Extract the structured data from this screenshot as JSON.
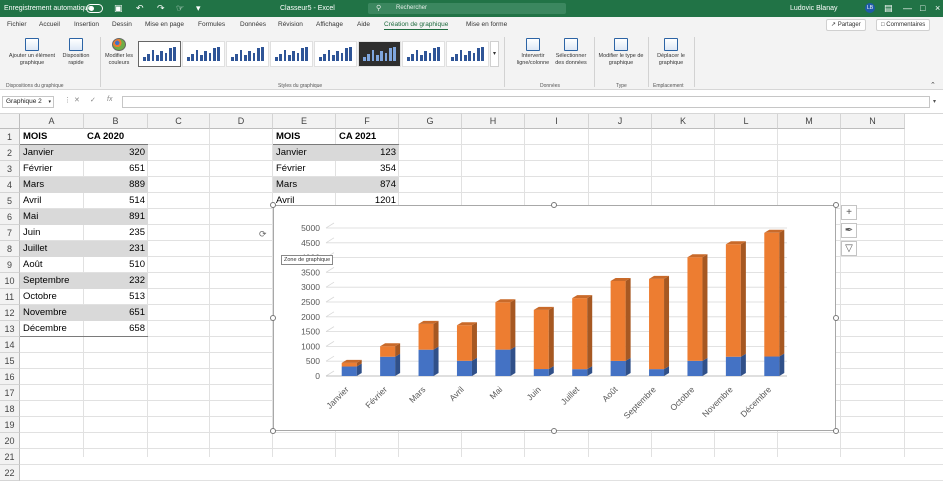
{
  "titlebar": {
    "autosave_label": "Enregistrement automatique",
    "filename": "Classeur5 - Excel",
    "search_placeholder": "Rechercher",
    "user_name": "Ludovic Blanay",
    "user_initials": "LB"
  },
  "menu": {
    "tabs": [
      "Fichier",
      "Accueil",
      "Insertion",
      "Dessin",
      "Mise en page",
      "Formules",
      "Données",
      "Révision",
      "Affichage",
      "Aide",
      "Création de graphique",
      "Mise en forme"
    ],
    "active_tab": "Création de graphique",
    "share_label": "Partager",
    "comments_label": "Commentaires"
  },
  "ribbon": {
    "add_element": "Ajouter un élément graphique",
    "quick_layout": "Disposition rapide",
    "change_colors": "Modifier les couleurs",
    "switch_row_col": "Intervertir ligne/colonne",
    "select_data": "Sélectionner des données",
    "change_type": "Modifier le type de graphique",
    "move_chart": "Déplacer le graphique",
    "groups": {
      "layouts": "Dispositions du graphique",
      "styles": "Styles du graphique",
      "data": "Données",
      "type": "Type",
      "location": "Emplacement"
    }
  },
  "formula_bar": {
    "name_box": "Graphique 2",
    "fx": "fx",
    "formula": ""
  },
  "sheet": {
    "columns": [
      "A",
      "B",
      "C",
      "D",
      "E",
      "F",
      "G",
      "H",
      "I",
      "J",
      "K",
      "L",
      "M",
      "N"
    ],
    "rows": [
      "1",
      "2",
      "3",
      "4",
      "5",
      "6",
      "7",
      "8",
      "9",
      "10",
      "11",
      "12",
      "13",
      "14",
      "15",
      "16",
      "17",
      "18",
      "19",
      "20",
      "21",
      "22"
    ],
    "table1": {
      "headers": [
        "MOIS",
        "CA 2020"
      ],
      "rows": [
        [
          "Janvier",
          "320"
        ],
        [
          "Février",
          "651"
        ],
        [
          "Mars",
          "889"
        ],
        [
          "Avril",
          "514"
        ],
        [
          "Mai",
          "891"
        ],
        [
          "Juin",
          "235"
        ],
        [
          "Juillet",
          "231"
        ],
        [
          "Août",
          "510"
        ],
        [
          "Septembre",
          "232"
        ],
        [
          "Octobre",
          "513"
        ],
        [
          "Novembre",
          "651"
        ],
        [
          "Décembre",
          "658"
        ]
      ]
    },
    "table2": {
      "headers": [
        "MOIS",
        "CA 2021"
      ],
      "rows": [
        [
          "Janvier",
          "123"
        ],
        [
          "Février",
          "354"
        ],
        [
          "Mars",
          "874"
        ],
        [
          "Avril",
          "1201"
        ]
      ]
    }
  },
  "chart_tooltip": "Zone de graphique",
  "chart_data": {
    "type": "bar",
    "stacked": true,
    "three_d": true,
    "categories": [
      "Janvier",
      "Février",
      "Mars",
      "Avril",
      "Mai",
      "Juin",
      "Juillet",
      "Août",
      "Septembre",
      "Octobre",
      "Novembre",
      "Décembre"
    ],
    "series": [
      {
        "values": [
          320,
          651,
          889,
          514,
          891,
          235,
          231,
          510,
          232,
          513,
          651,
          658
        ],
        "color": "#4472c4"
      },
      {
        "values": [
          123,
          354,
          874,
          1201,
          1600,
          2000,
          2400,
          2700,
          3050,
          3500,
          3800,
          4180
        ],
        "color": "#ed7d31"
      }
    ],
    "y_ticks": [
      "0",
      "500",
      "1000",
      "1500",
      "2000",
      "2500",
      "3000",
      "3500",
      "4000",
      "4500",
      "5000"
    ],
    "ylim": [
      0,
      5000
    ],
    "grid": true,
    "legend": "none"
  },
  "colors": {
    "excel_green": "#217346",
    "series1": "#4472c4",
    "series2": "#ed7d31"
  }
}
